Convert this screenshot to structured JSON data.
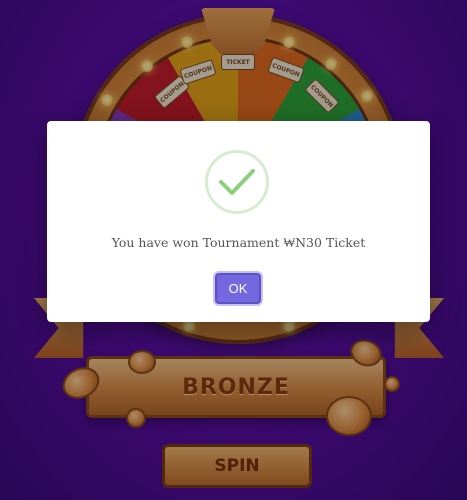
{
  "wheel": {
    "segment_label": "COUPON",
    "pointer_label": "TICKET",
    "pointer_value": "₩N30"
  },
  "banner": {
    "label": "BRONZE"
  },
  "spin_button": {
    "label": "SPIN"
  },
  "modal": {
    "message": "You have won Tournament ₩N30 Ticket",
    "ok_label": "OK",
    "icon": "checkmark-icon",
    "colors": {
      "check": "#8ccf7e",
      "ok_button": "#7467e0"
    }
  }
}
